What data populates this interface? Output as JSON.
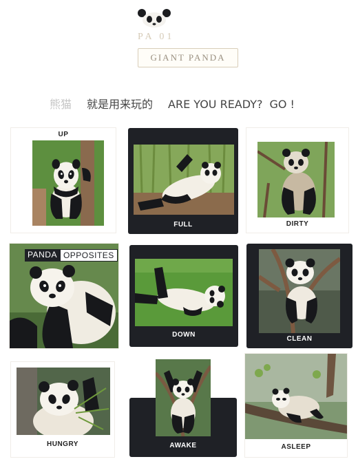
{
  "header": {
    "brand_faded": "PA    01",
    "brand_title": "GIANT PANDA",
    "tagline_faded": "熊猫",
    "tagline_zh": "就是用来玩的",
    "tagline_en": "ARE YOU READY?",
    "tagline_go": "GO !",
    "logo_icon": "panda-face-icon"
  },
  "grid": {
    "overlay_word_a": "PANDA",
    "overlay_word_b": "OPPOSITES",
    "captions": {
      "up": "UP",
      "full": "FULL",
      "dirty": "DIRTY",
      "down": "DOWN",
      "clean": "CLEAN",
      "hungry": "HUNGRY",
      "awake": "AWAKE",
      "asleep": "ASLEEP"
    }
  },
  "colors": {
    "dark_card": "#1f2126",
    "grass": "#5c9a3c",
    "bamboo": "#86a85a",
    "bark": "#7a5a42",
    "fur_white": "#f3efe6",
    "fur_black": "#17181b"
  }
}
